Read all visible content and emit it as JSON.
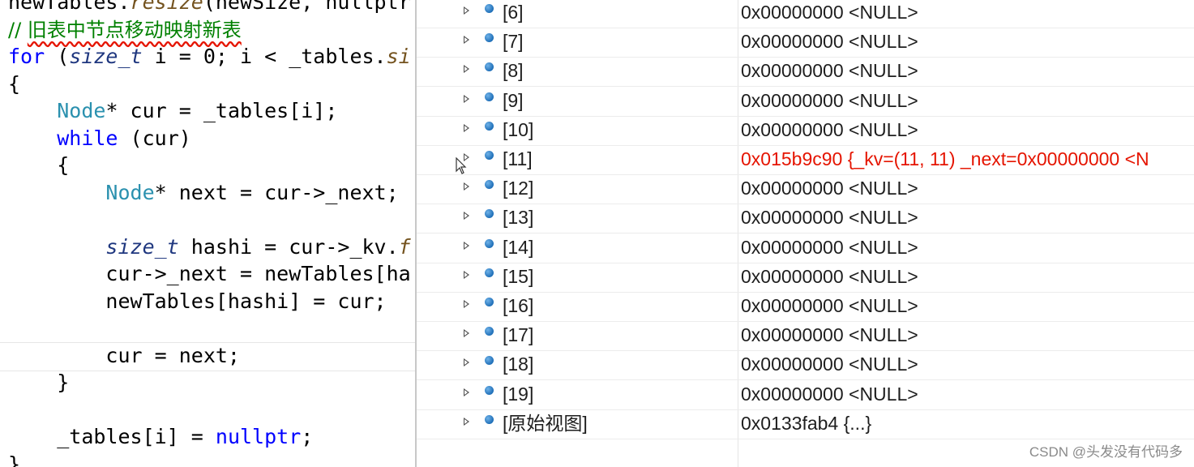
{
  "editor": {
    "lines": [
      {
        "indent": "",
        "parts": [
          {
            "text": "newTables.",
            "cls": ""
          },
          {
            "text": "resize",
            "cls": "fn"
          },
          {
            "text": "(newSize, nullptr",
            "cls": ""
          }
        ]
      },
      {
        "indent": "",
        "comment": {
          "prefix": "// ",
          "squiggled": "旧表中节点移动映射新表"
        }
      },
      {
        "indent": "",
        "parts": [
          {
            "text": "for",
            "cls": "kw"
          },
          {
            "text": " (",
            "cls": ""
          },
          {
            "text": "size_t",
            "cls": "it"
          },
          {
            "text": " i = 0; i < _tables.",
            "cls": ""
          },
          {
            "text": "si",
            "cls": "fn"
          }
        ]
      },
      {
        "indent": "",
        "parts": [
          {
            "text": "{",
            "cls": ""
          }
        ]
      },
      {
        "indent": "    ",
        "parts": [
          {
            "text": "Node",
            "cls": "ty"
          },
          {
            "text": "* cur = _tables[i];",
            "cls": ""
          }
        ]
      },
      {
        "indent": "    ",
        "parts": [
          {
            "text": "while",
            "cls": "kw"
          },
          {
            "text": " (cur)",
            "cls": ""
          }
        ]
      },
      {
        "indent": "    ",
        "parts": [
          {
            "text": "{",
            "cls": ""
          }
        ]
      },
      {
        "indent": "        ",
        "parts": [
          {
            "text": "Node",
            "cls": "ty"
          },
          {
            "text": "* next = cur->_next;",
            "cls": ""
          }
        ]
      },
      {
        "indent": "",
        "parts": []
      },
      {
        "indent": "        ",
        "parts": [
          {
            "text": "size_t",
            "cls": "it"
          },
          {
            "text": " hashi = cur->_kv.",
            "cls": ""
          },
          {
            "text": "f",
            "cls": "fn"
          }
        ]
      },
      {
        "indent": "        ",
        "parts": [
          {
            "text": "cur->_next = newTables[ha",
            "cls": ""
          }
        ]
      },
      {
        "indent": "        ",
        "parts": [
          {
            "text": "newTables[hashi] = cur;",
            "cls": ""
          }
        ]
      },
      {
        "indent": "",
        "parts": []
      },
      {
        "indent": "        ",
        "parts": [
          {
            "text": "cur = next;",
            "cls": ""
          }
        ]
      },
      {
        "indent": "    ",
        "parts": [
          {
            "text": "}",
            "cls": ""
          }
        ]
      },
      {
        "indent": "",
        "parts": []
      },
      {
        "indent": "    ",
        "parts": [
          {
            "text": "_tables[i] = ",
            "cls": ""
          },
          {
            "text": "nullptr",
            "cls": "kw"
          },
          {
            "text": ";",
            "cls": ""
          }
        ]
      },
      {
        "indent": "",
        "parts": [
          {
            "text": "}",
            "cls": ""
          }
        ]
      }
    ]
  },
  "watch": {
    "rows": [
      {
        "name": "[6]",
        "value": "0x00000000 <NULL>",
        "changed": false
      },
      {
        "name": "[7]",
        "value": "0x00000000 <NULL>",
        "changed": false
      },
      {
        "name": "[8]",
        "value": "0x00000000 <NULL>",
        "changed": false
      },
      {
        "name": "[9]",
        "value": "0x00000000 <NULL>",
        "changed": false
      },
      {
        "name": "[10]",
        "value": "0x00000000 <NULL>",
        "changed": false
      },
      {
        "name": "[11]",
        "value": "0x015b9c90 {_kv=(11, 11) _next=0x00000000 <N",
        "changed": true
      },
      {
        "name": "[12]",
        "value": "0x00000000 <NULL>",
        "changed": false
      },
      {
        "name": "[13]",
        "value": "0x00000000 <NULL>",
        "changed": false
      },
      {
        "name": "[14]",
        "value": "0x00000000 <NULL>",
        "changed": false
      },
      {
        "name": "[15]",
        "value": "0x00000000 <NULL>",
        "changed": false
      },
      {
        "name": "[16]",
        "value": "0x00000000 <NULL>",
        "changed": false
      },
      {
        "name": "[17]",
        "value": "0x00000000 <NULL>",
        "changed": false
      },
      {
        "name": "[18]",
        "value": "0x00000000 <NULL>",
        "changed": false
      },
      {
        "name": "[19]",
        "value": "0x00000000 <NULL>",
        "changed": false
      },
      {
        "name": "[原始视图]",
        "value": "0x0133fab4 {...}",
        "changed": false
      }
    ],
    "changed_value_color": "#e51400",
    "field_icon": "field-icon",
    "expander_icon": "expand-triangle-icon"
  },
  "watermark": "CSDN @头发没有代码多"
}
